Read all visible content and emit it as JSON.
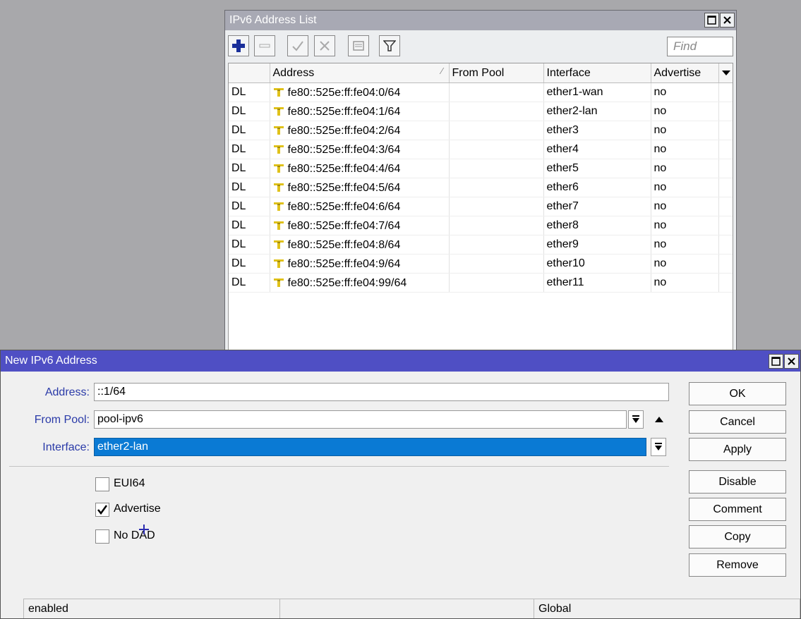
{
  "list_window": {
    "title": "IPv6 Address List",
    "find_placeholder": "Find",
    "columns": [
      "",
      "Address",
      "From Pool",
      "Interface",
      "Advertise"
    ],
    "rows": [
      {
        "flags": "DL",
        "address": "fe80::525e:ff:fe04:0/64",
        "pool": "",
        "interface": "ether1-wan",
        "advertise": "no"
      },
      {
        "flags": "DL",
        "address": "fe80::525e:ff:fe04:1/64",
        "pool": "",
        "interface": "ether2-lan",
        "advertise": "no"
      },
      {
        "flags": "DL",
        "address": "fe80::525e:ff:fe04:2/64",
        "pool": "",
        "interface": "ether3",
        "advertise": "no"
      },
      {
        "flags": "DL",
        "address": "fe80::525e:ff:fe04:3/64",
        "pool": "",
        "interface": "ether4",
        "advertise": "no"
      },
      {
        "flags": "DL",
        "address": "fe80::525e:ff:fe04:4/64",
        "pool": "",
        "interface": "ether5",
        "advertise": "no"
      },
      {
        "flags": "DL",
        "address": "fe80::525e:ff:fe04:5/64",
        "pool": "",
        "interface": "ether6",
        "advertise": "no"
      },
      {
        "flags": "DL",
        "address": "fe80::525e:ff:fe04:6/64",
        "pool": "",
        "interface": "ether7",
        "advertise": "no"
      },
      {
        "flags": "DL",
        "address": "fe80::525e:ff:fe04:7/64",
        "pool": "",
        "interface": "ether8",
        "advertise": "no"
      },
      {
        "flags": "DL",
        "address": "fe80::525e:ff:fe04:8/64",
        "pool": "",
        "interface": "ether9",
        "advertise": "no"
      },
      {
        "flags": "DL",
        "address": "fe80::525e:ff:fe04:9/64",
        "pool": "",
        "interface": "ether10",
        "advertise": "no"
      },
      {
        "flags": "DL",
        "address": "fe80::525e:ff:fe04:99/64",
        "pool": "",
        "interface": "ether11",
        "advertise": "no"
      }
    ]
  },
  "dialog": {
    "title": "New IPv6 Address",
    "address_label": "Address:",
    "address_value": "::1/64",
    "pool_label": "From Pool:",
    "pool_value": "pool-ipv6",
    "interface_label": "Interface:",
    "interface_value": "ether2-lan",
    "eui64_label": "EUI64",
    "eui64_checked": false,
    "advertise_label": "Advertise",
    "advertise_checked": true,
    "nodad_label": "No DAD",
    "nodad_checked": false,
    "buttons": {
      "ok": "OK",
      "cancel": "Cancel",
      "apply": "Apply",
      "disable": "Disable",
      "comment": "Comment",
      "copy": "Copy",
      "remove": "Remove"
    },
    "status": {
      "left": "enabled",
      "middle": "",
      "right": "Global"
    }
  },
  "colors": {
    "dialog_titlebar": "#4f4fc4",
    "list_titlebar": "#a8a9b4",
    "label_blue": "#2a3aa8",
    "selection": "#0a7ad4",
    "add_icon": "#1a2f9a",
    "address_icon": "#e0c21a"
  },
  "icons": [
    "add-icon",
    "remove-icon",
    "enable-icon",
    "disable-icon",
    "comment-icon",
    "filter-icon",
    "maximize-icon",
    "close-icon",
    "dropdown-icon",
    "sort-icon",
    "checkmark-icon",
    "address-key-icon"
  ]
}
